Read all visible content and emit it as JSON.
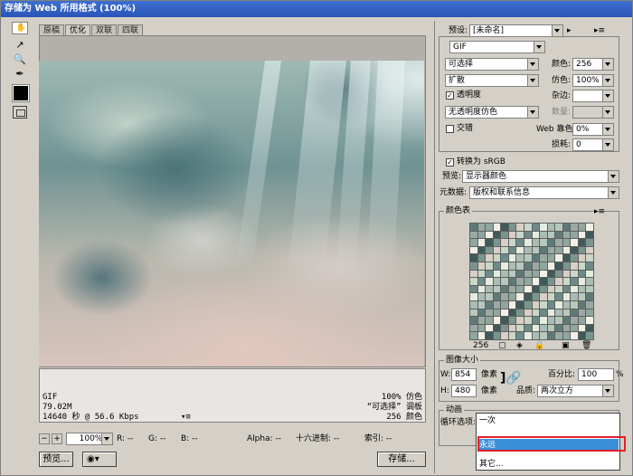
{
  "window": {
    "title": "存储为 Web 所用格式 (100%)"
  },
  "tabs": [
    "原稿",
    "优化",
    "双联",
    "四联"
  ],
  "image_info": {
    "format": "GIF",
    "size": "79.02M",
    "time": "14640 秒 @ 56.6 Kbps",
    "time_menu": "▾≡",
    "quality": "100% 仿色",
    "palette": "“可选择” 调板",
    "colors": "256 颜色"
  },
  "statusbar": {
    "zoom": "100%",
    "r": "R: --",
    "g": "G: --",
    "b": "B: --",
    "alpha": "Alpha: --",
    "hex": "十六进制: --",
    "index": "索引: --"
  },
  "buttons": {
    "preview": "预览...",
    "save": "存储..."
  },
  "settings": {
    "preset_label": "预设:",
    "preset_value": "[未命名]",
    "format": "GIF",
    "reduction": "可选择",
    "colors_label": "颜色:",
    "colors_value": "256",
    "dither_algo": "扩散",
    "dither_label": "仿色:",
    "dither_value": "100%",
    "transparency_label": "透明度",
    "matte_label": "杂边:",
    "trans_dither": "无透明度仿色",
    "amount_label": "数量:",
    "interlaced_label": "交错",
    "web_snap_label": "Web 靠色:",
    "web_snap_value": "0%",
    "lossy_label": "损耗:",
    "lossy_value": "0",
    "srgb_label": "转换为 sRGB",
    "preview_label": "预览:",
    "preview_value": "显示器颜色",
    "metadata_label": "元数据:",
    "metadata_value": "版权和联系信息"
  },
  "color_table": {
    "title": "颜色表",
    "count": "256"
  },
  "image_size": {
    "title": "图像大小",
    "w_label": "W:",
    "w_value": "854",
    "h_label": "H:",
    "h_value": "480",
    "unit": "像素",
    "percent_label": "百分比:",
    "percent_value": "100",
    "percent_unit": "%",
    "quality_label": "品质:",
    "quality_value": "两次立方"
  },
  "animation": {
    "title": "动画",
    "loop_label": "循环选项:",
    "loop_value": "一次"
  },
  "loop_menu": {
    "items": [
      "一次",
      "永远",
      "其它..."
    ],
    "selected": "永远"
  },
  "colors": {
    "title_bar": "#2a55b8",
    "menu_highlight": "#3a8fd8",
    "red_box": "#e0202a"
  }
}
